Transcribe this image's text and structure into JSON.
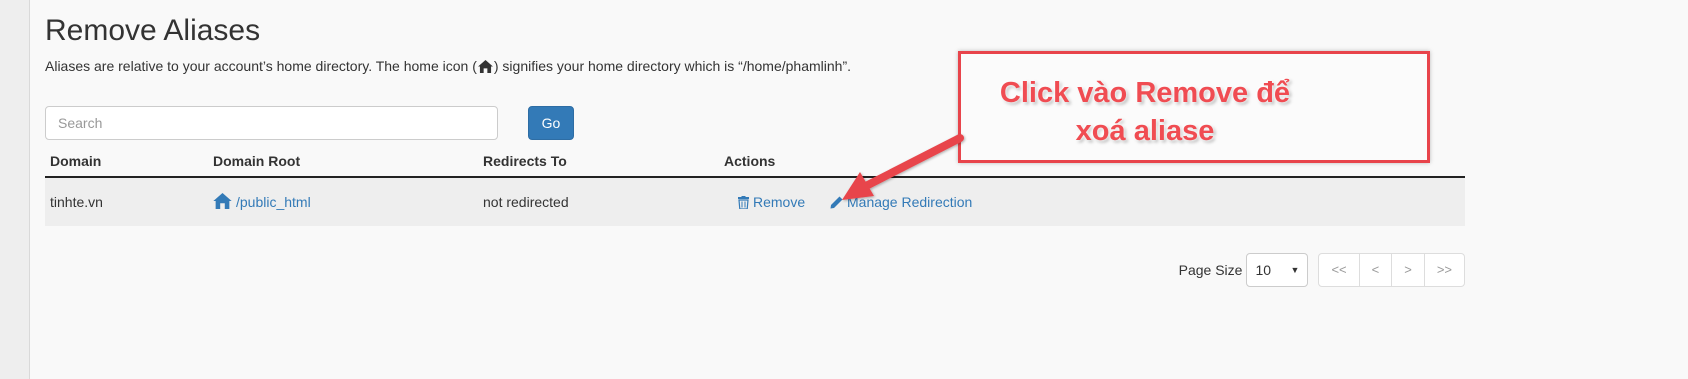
{
  "page": {
    "title": "Remove Aliases",
    "description_before": "Aliases are relative to your account’s home directory. The home icon (",
    "description_after": ") signifies your home directory which is “/home/phamlinh”."
  },
  "search": {
    "placeholder": "Search",
    "value": "",
    "go_label": "Go"
  },
  "table": {
    "headers": {
      "domain": "Domain",
      "domain_root": "Domain Root",
      "redirects_to": "Redirects To",
      "actions": "Actions"
    },
    "rows": [
      {
        "domain": "tinhte.vn",
        "domain_root": "/public_html",
        "redirects_to": "not redirected",
        "remove_label": "Remove",
        "manage_label": "Manage Redirection"
      }
    ]
  },
  "pager": {
    "page_size_label": "Page Size",
    "page_size_value": "10",
    "first": "<<",
    "prev": "<",
    "next": ">",
    "last": ">>"
  },
  "annotation": {
    "line1": "Click vào Remove để",
    "line2": "xoá aliase",
    "color": "#e8444b"
  },
  "colors": {
    "primary": "#337ab7",
    "link": "#337ab7",
    "row_bg": "#eeeeee"
  },
  "icons": {
    "home": "home-icon",
    "trash": "trash-icon",
    "pencil": "pencil-icon",
    "caret": "caret-down-icon"
  }
}
